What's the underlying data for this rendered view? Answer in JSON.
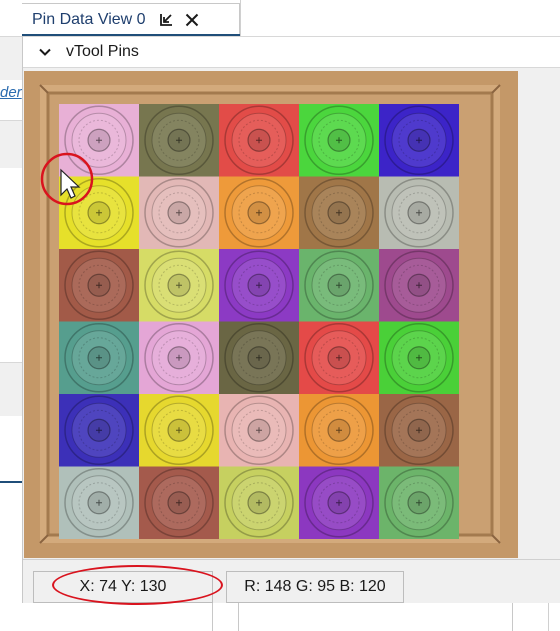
{
  "tab": {
    "title": "Pin Data View 0",
    "icons": [
      "undock-icon",
      "close-icon"
    ]
  },
  "background_app": {
    "link_fragment": "der"
  },
  "section": {
    "title": "vTool Pins",
    "chevron": "chevron-down-icon"
  },
  "image_view": {
    "content": "box of batteries (5 columns x 6 rows) with colored pin overlays",
    "pin_colors_by_row": [
      [
        "#e8b0d6",
        "#77764f",
        "#e24c48",
        "#4bd63d",
        "#3c24c8"
      ],
      [
        "#e6e02a",
        "#e2b8b6",
        "#ee9a3a",
        "#a07648",
        "#b8bcb2"
      ],
      [
        "#a25a48",
        "#d6dc66",
        "#8c3ac4",
        "#6ab46c",
        "#9e4a8e"
      ],
      [
        "#569e8e",
        "#e4a6d6",
        "#6a6644",
        "#e44a48",
        "#4ad038"
      ],
      [
        "#3c30b8",
        "#e6d82e",
        "#e8b4b2",
        "#ec9634",
        "#9a6646"
      ],
      [
        "#b0c0ba",
        "#a45a4c",
        "#c6d060",
        "#8c38c0",
        "#6cb46a"
      ]
    ],
    "cursor": "pointer-cursor-icon",
    "highlight": "red-circle-annotation"
  },
  "status_bar": {
    "coordinates": "X: 74 Y: 130",
    "rgb": "R: 148 G: 95 B: 120"
  },
  "colors": {
    "accent": "#1f4e79",
    "annotation_red": "#d9131e",
    "panel_bg": "#f0f0f0",
    "cardboard": "#c89a6b"
  }
}
